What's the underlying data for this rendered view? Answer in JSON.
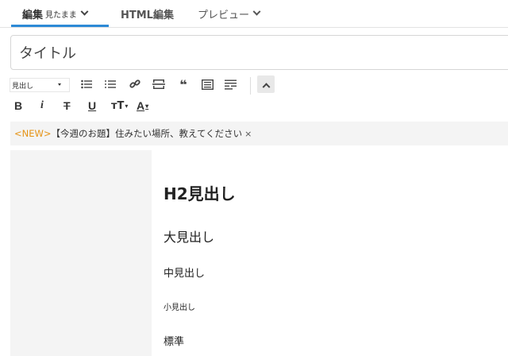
{
  "tabs": {
    "edit": {
      "label": "編集",
      "sub": "見たまま"
    },
    "html": {
      "label": "HTML編集"
    },
    "preview": {
      "label": "プレビュー"
    }
  },
  "title_placeholder": "タイトル",
  "toolbar": {
    "heading_select": "見出し",
    "row1_icons": [
      "bulleted-list-icon",
      "numbered-list-icon",
      "link-icon",
      "horizontal-rule-icon",
      "quote-icon",
      "table-of-contents-icon",
      "insert-more-icon"
    ],
    "row2": {
      "bold": "B",
      "italic": "i",
      "strike": "T",
      "underline": "U",
      "font_size": "тT",
      "font_color": "A"
    }
  },
  "notice": {
    "tag": "<NEW>",
    "text": "【今週のお題】住みたい場所、教えてください",
    "close": "×"
  },
  "editor": {
    "h2": "H2見出し",
    "large": "大見出し",
    "medium": "中見出し",
    "small": "小見出し",
    "normal": "標準"
  }
}
